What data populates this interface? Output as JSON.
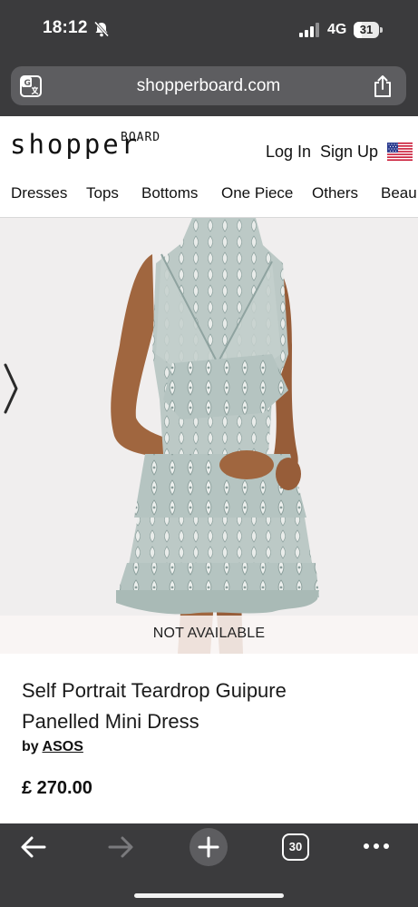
{
  "status_bar": {
    "time": "18:12",
    "network": "4G",
    "battery": "31",
    "battery_level": 0.31
  },
  "browser": {
    "url": "shopperboard.com",
    "tab_count": "30"
  },
  "site": {
    "logo_main": "shopper",
    "logo_sup": "BOARD",
    "login": "Log In",
    "signup": "Sign Up",
    "nav": [
      "Dresses",
      "Tops",
      "Bottoms",
      "One Piece",
      "Others",
      "Beau"
    ]
  },
  "product": {
    "availability": "NOT AVAILABLE",
    "title_line1": "Self Portrait Teardrop Guipure",
    "title_line2": "Panelled Mini Dress",
    "by_label": "by",
    "brand": "ASOS",
    "price": "£ 270.00"
  },
  "colors": {
    "chrome": "#3b3b3d",
    "url_bar": "#5d5d60",
    "dress": "#b9c7c4",
    "skin": "#a0663f",
    "background": "#f0eeee"
  }
}
